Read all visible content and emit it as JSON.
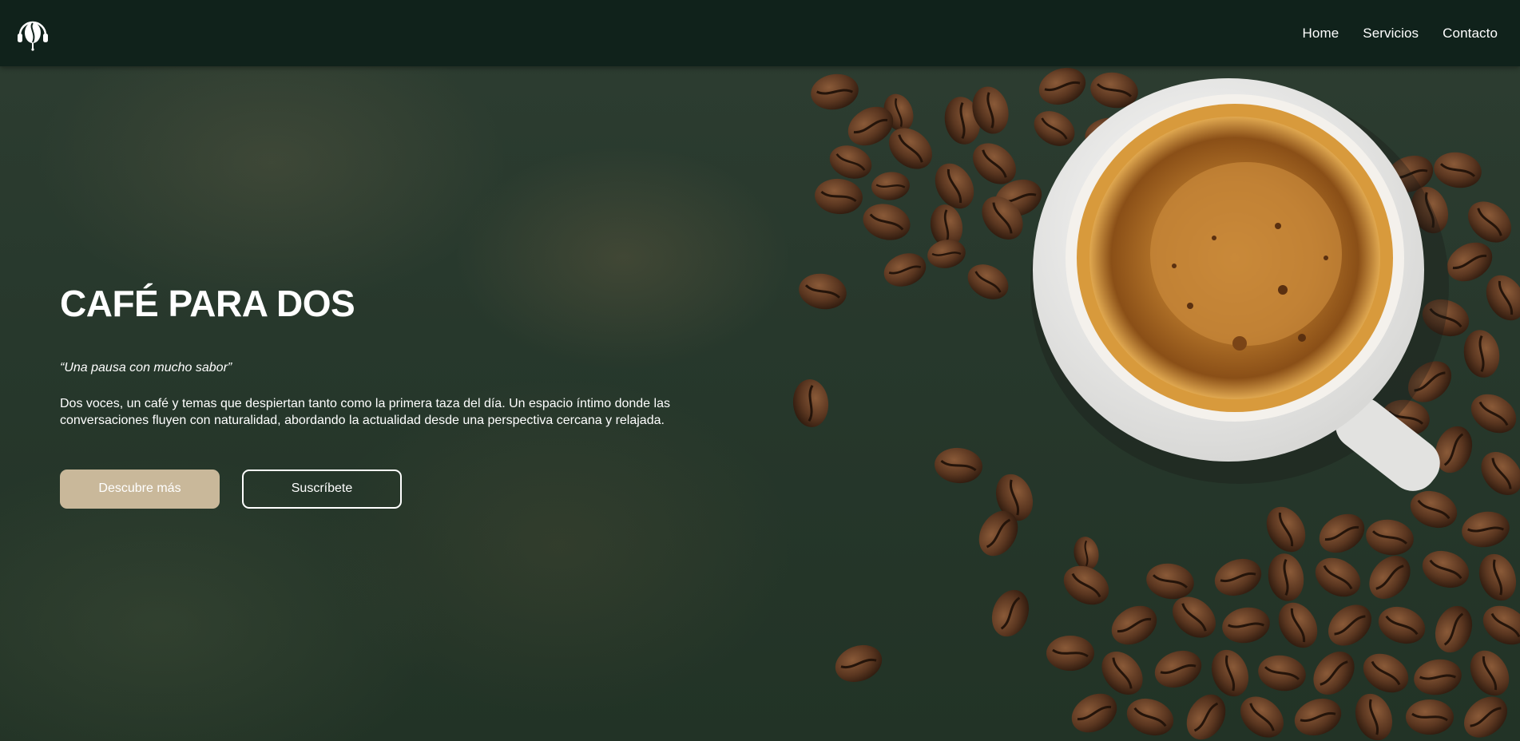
{
  "header": {
    "logo_icon": "headphones-coffee-bean-logo-icon",
    "nav": [
      {
        "label": "Home"
      },
      {
        "label": "Servicios"
      },
      {
        "label": "Contacto"
      }
    ]
  },
  "hero": {
    "title": "CAFÉ PARA DOS",
    "tagline": "“Una pausa con mucho sabor”",
    "description": "Dos voces, un café y temas que despiertan tanto como la primera taza del día. Un espacio íntimo donde las conversaciones fluyen con naturalidad, abordando la actualidad desde una perspectiva cercana y relajada.",
    "primary_button": "Descubre más",
    "secondary_button": "Suscríbete",
    "image": "coffee-cup-with-beans-illustration"
  },
  "colors": {
    "navbar": "#10221b",
    "hero_background": "#27382c",
    "primary_button": "#c9b89a",
    "text": "#ffffff"
  }
}
